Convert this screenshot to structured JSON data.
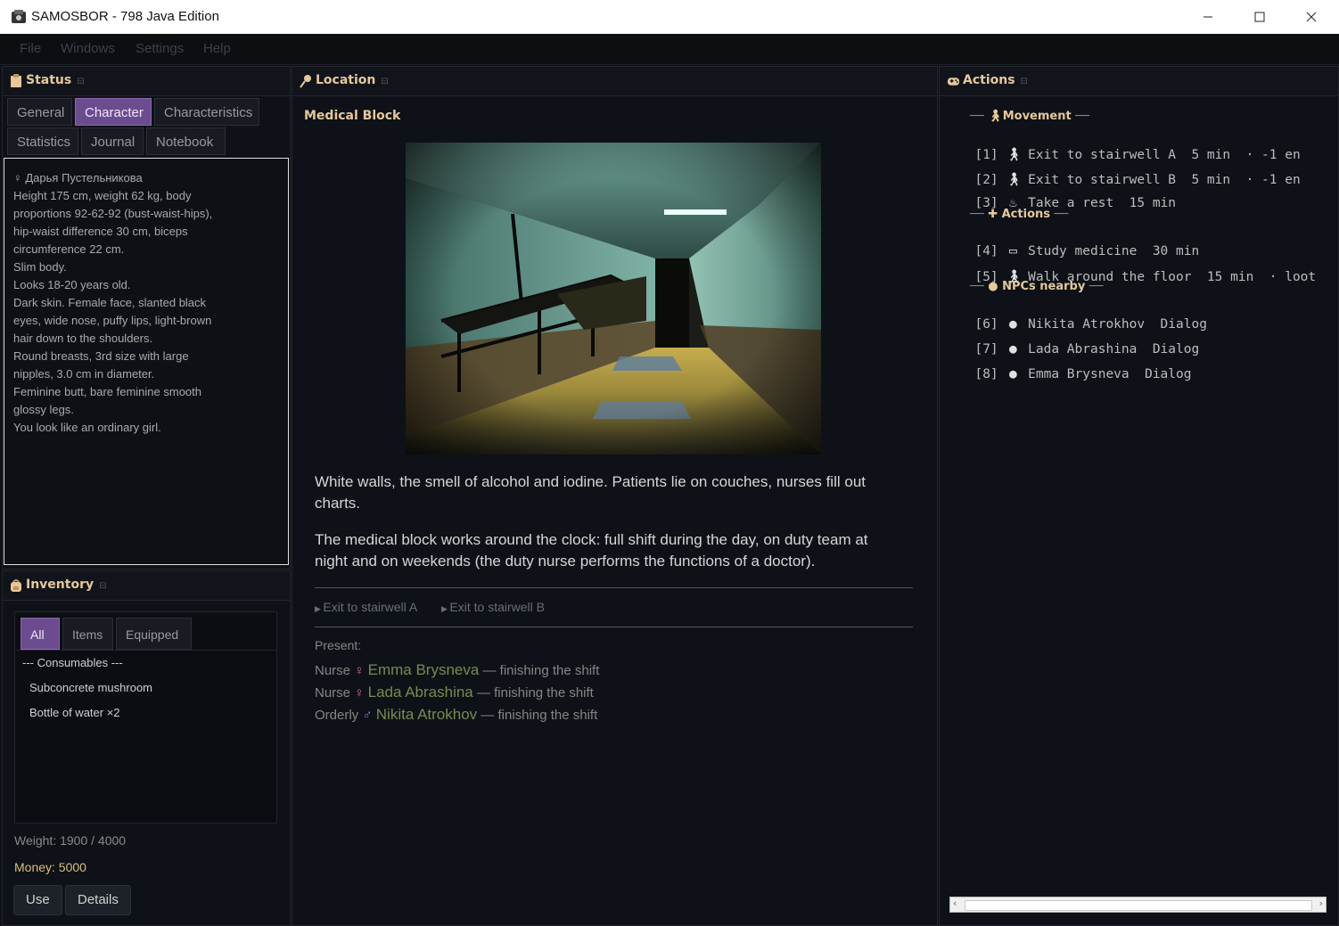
{
  "window": {
    "title": "SAMOSBOR - 798 Java Edition"
  },
  "menu": [
    "File",
    "Windows",
    "Settings",
    "Help"
  ],
  "status": {
    "title": "Status",
    "tabs": [
      "General",
      "Character",
      "Characteristics",
      "Statistics",
      "Journal",
      "Notebook"
    ],
    "active_tab": "Character",
    "character_lines": [
      "♀ Дарья Пустельникова",
      "Height 175 cm, weight 62 kg, body",
      "proportions 92-62-92 (bust-waist-hips),",
      "hip-waist difference 30 cm, biceps",
      "circumference 22 cm.",
      "Slim body.",
      "Looks 18-20 years old.",
      "Dark skin. Female face, slanted black",
      "eyes, wide nose, puffy lips, light-brown",
      "hair down to the shoulders.",
      "Round breasts, 3rd size with large",
      "nipples, 3.0 cm in diameter.",
      "Feminine butt, bare feminine smooth",
      "glossy legs.",
      "You look like an ordinary girl."
    ]
  },
  "inventory": {
    "title": "Inventory",
    "tabs": [
      "All",
      "Items",
      "Equipped"
    ],
    "active_tab": "All",
    "category": "--- Consumables ---",
    "items": [
      "Subconcrete mushroom",
      "Bottle of water ×2"
    ],
    "weight": "Weight: 1900 / 4000",
    "money": "Money: 5000",
    "use_label": "Use",
    "details_label": "Details"
  },
  "location": {
    "title": "Location",
    "name": "Medical Block",
    "desc1_line1": "White walls, the smell of alcohol and iodine. Patients lie on couches, nurses fill out",
    "desc1_line2": "charts.",
    "desc2_line1": "The medical block works around the clock: full shift during the day, on duty team at",
    "desc2_line2": "night and on weekends (the duty nurse performs the functions of a doctor).",
    "exits": [
      "Exit to stairwell A",
      "Exit to stairwell B"
    ],
    "present_label": "Present:",
    "present": [
      {
        "role": "Nurse",
        "gender": "♀",
        "name": "Emma Brysneva",
        "note": "— finishing the shift"
      },
      {
        "role": "Nurse",
        "gender": "♀",
        "name": "Lada Abrashina",
        "note": "— finishing the shift"
      },
      {
        "role": "Orderly",
        "gender": "♂",
        "name": "Nikita Atrokhov",
        "note": "— finishing the shift"
      }
    ]
  },
  "actions": {
    "title": "Actions",
    "groups": {
      "movement": "Movement",
      "actions": "Actions",
      "npcs": "NPCs nearby"
    },
    "rows": [
      {
        "num": "[1]",
        "icon": "walk-icon",
        "text": "Exit to stairwell A  5 min  · -1 en"
      },
      {
        "num": "[2]",
        "icon": "walk-icon",
        "text": "Exit to stairwell B  5 min  · -1 en"
      },
      {
        "num": "[3]",
        "icon": "rest-icon",
        "text": "Take a rest  15 min"
      },
      {
        "num": "[4]",
        "icon": "book-icon",
        "text": "Study medicine  30 min"
      },
      {
        "num": "[5]",
        "icon": "walk-icon",
        "text": "Walk around the floor  15 min  · loot"
      },
      {
        "num": "[6]",
        "icon": "speech-icon",
        "text": "Nikita Atrokhov  Dialog"
      },
      {
        "num": "[7]",
        "icon": "speech-icon",
        "text": "Lada Abrashina  Dialog"
      },
      {
        "num": "[8]",
        "icon": "speech-icon",
        "text": "Emma Brysneva  Dialog"
      }
    ]
  }
}
